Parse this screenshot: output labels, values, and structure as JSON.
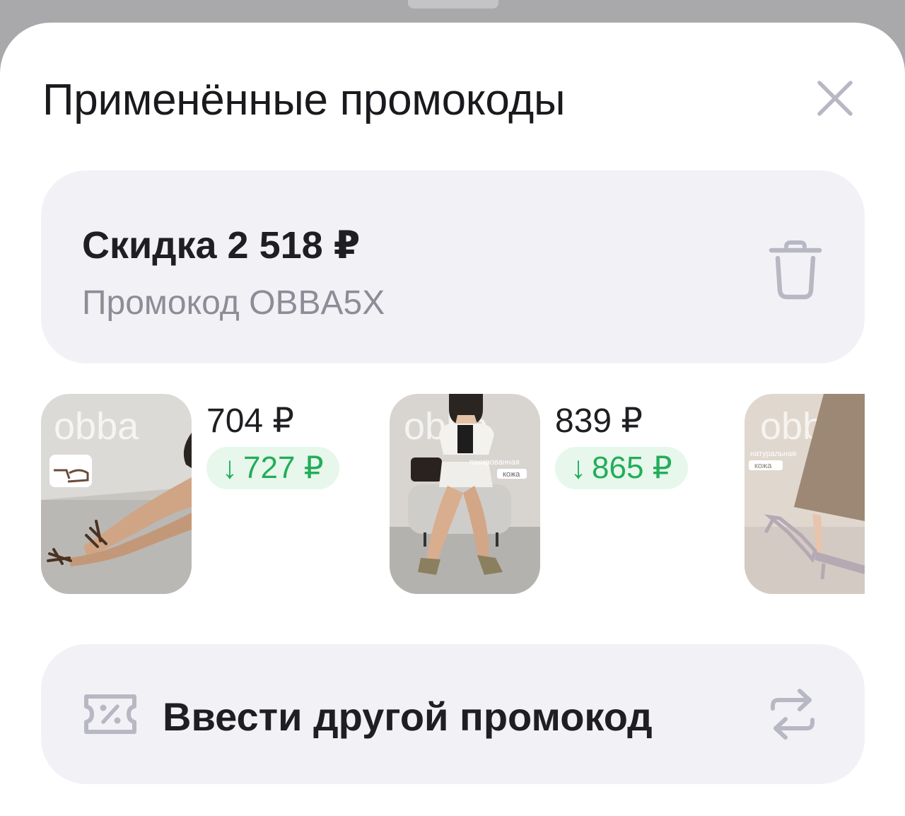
{
  "sheet": {
    "title": "Применённые промокоды"
  },
  "promo": {
    "discount": "Скидка 2 518 ₽",
    "code": "Промокод OBBA5X"
  },
  "products": [
    {
      "price": "704 ₽",
      "old_price": "727 ₽",
      "brand": "obba"
    },
    {
      "price": "839 ₽",
      "old_price": "865 ₽",
      "brand": "obba",
      "tag1": "лакированная",
      "tag2": "кожа"
    },
    {
      "brand": "obbo",
      "tag1": "натуральная",
      "tag2": "кожа"
    }
  ],
  "arrow_glyph": "↓",
  "enter": {
    "label": "Ввести другой промокод"
  },
  "colors": {
    "accent_green": "#23ad5a",
    "green_bg": "#e7f7ec",
    "card_bg": "#f2f2f6",
    "icon_gray": "#b8b8c4"
  },
  "icons": {
    "close": "close-icon",
    "trash": "trash-icon",
    "ticket": "percent-ticket-icon",
    "swap": "swap-arrows-icon"
  }
}
